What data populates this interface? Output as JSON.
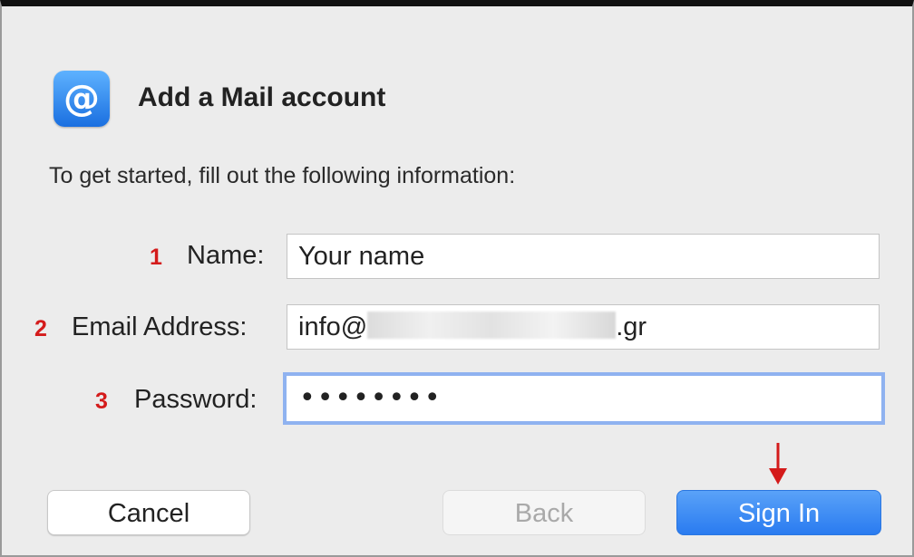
{
  "dialog": {
    "title": "Add a Mail account",
    "intro": "To get started, fill out the following information:",
    "icon": "at-sign-icon",
    "icon_glyph": "@"
  },
  "fields": {
    "name": {
      "number": "1",
      "label": "Name:",
      "value": "Your name"
    },
    "email": {
      "number": "2",
      "label": "Email Address:",
      "value_prefix": "info@",
      "value_suffix": ".gr"
    },
    "password": {
      "number": "3",
      "label": "Password:",
      "value": "••••••••"
    }
  },
  "buttons": {
    "cancel": "Cancel",
    "back": "Back",
    "sign_in": "Sign In"
  },
  "annotation": {
    "number_color": "#d41b1b",
    "arrow_color": "#d41b1b",
    "arrow_target": "sign-in-button"
  },
  "colors": {
    "accent": "#2a7bf0",
    "focus_ring": "#8fb2f0"
  }
}
